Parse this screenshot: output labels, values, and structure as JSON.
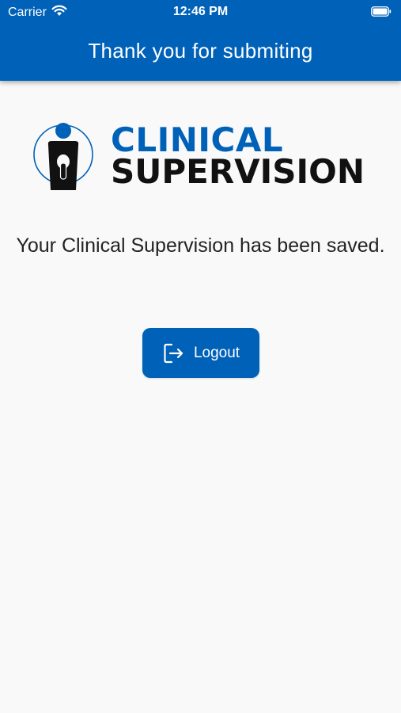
{
  "status_bar": {
    "carrier": "Carrier",
    "time": "12:46 PM"
  },
  "header": {
    "title": "Thank you for submiting"
  },
  "logo": {
    "line1": "CLINICAL",
    "line2": "SUPERVISION"
  },
  "main": {
    "message": "Your Clinical Supervision has been saved.",
    "logout_label": "Logout"
  },
  "colors": {
    "primary": "#0061b8",
    "background": "#f9f9f9",
    "text": "#222222"
  },
  "icons": {
    "wifi": "wifi-icon",
    "battery": "battery-icon",
    "logout": "logout-icon"
  }
}
